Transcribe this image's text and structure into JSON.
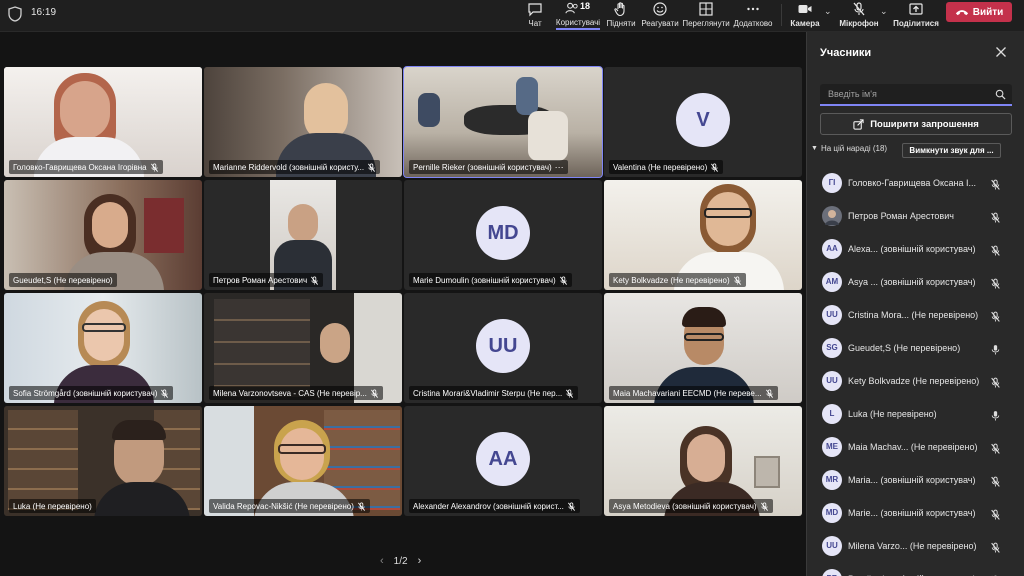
{
  "status": {
    "time": "16:19"
  },
  "toolbar": {
    "chat": "Чат",
    "people": "Користувачі",
    "people_count": "18",
    "raise": "Підняти",
    "react": "Реагувати",
    "view": "Переглянути",
    "more": "Додатково",
    "camera": "Камера",
    "mic": "Мікрофон",
    "share": "Поділитися",
    "leave": "Вийти"
  },
  "grid": {
    "tiles": [
      {
        "name": "Головко-Гаврищева Оксана Ігорівна",
        "type": "video",
        "mic": "off"
      },
      {
        "name": "Marianne Riddervold (зовнішній користу...",
        "type": "video",
        "mic": "off"
      },
      {
        "name": "Pernille Rieker (зовнішній користувач)",
        "type": "video",
        "mic": "more"
      },
      {
        "name": "Valentina (Не перевірено)",
        "type": "avatar",
        "initials": "V",
        "mic": "off"
      },
      {
        "name": "Gueudet,S (Не перевірено)",
        "type": "video",
        "mic": "none"
      },
      {
        "name": "Петров Роман Арестович",
        "type": "video",
        "mic": "off"
      },
      {
        "name": "Marie Dumoulin (зовнішній користувач)",
        "type": "avatar",
        "initials": "MD",
        "mic": "off"
      },
      {
        "name": "Kety Bolkvadze (Не перевірено)",
        "type": "video",
        "mic": "off"
      },
      {
        "name": "Sofia Strömgård (зовнішній користувач)",
        "type": "video",
        "mic": "off"
      },
      {
        "name": "Milena Varzonovtseva - CAS (Не перевір...",
        "type": "video",
        "mic": "off"
      },
      {
        "name": "Cristina Morari&Vladimir Sterpu (Не пер...",
        "type": "avatar",
        "initials": "UU",
        "mic": "off"
      },
      {
        "name": "Maia Machavariani EECMD (Не переве...",
        "type": "video",
        "mic": "off"
      },
      {
        "name": "Luka (Не перевірено)",
        "type": "video",
        "mic": "none"
      },
      {
        "name": "Valida Repovac-Nikšić (Не перевірено)",
        "type": "video",
        "mic": "off"
      },
      {
        "name": "Alexander Alexandrov (зовнішній корист...",
        "type": "avatar",
        "initials": "AA",
        "mic": "off"
      },
      {
        "name": "Asya Metodieva (зовнішній користувач)",
        "type": "video",
        "mic": "off"
      }
    ],
    "pager": "1/2"
  },
  "panel": {
    "title": "Учасники",
    "search_placeholder": "Введіть ім'я",
    "share_invite": "Поширити запрошення",
    "section_label": "На цій нараді (18)",
    "mute_all": "Вимкнути звук для ...",
    "participants": [
      {
        "initials": "ГІ",
        "name": "Головко-Гаврищева Оксана І...",
        "mic": "off"
      },
      {
        "initials": "",
        "photo": true,
        "name": "Петров Роман Арестович",
        "mic": "off"
      },
      {
        "initials": "AA",
        "name": "Alexa... (зовнішній користувач)",
        "mic": "off"
      },
      {
        "initials": "AM",
        "name": "Asya ... (зовнішній користувач)",
        "mic": "off"
      },
      {
        "initials": "UU",
        "name": "Cristina Mora... (Не перевірено)",
        "mic": "off"
      },
      {
        "initials": "SG",
        "name": "Gueudet,S (Не перевірено)",
        "mic": "on"
      },
      {
        "initials": "UU",
        "name": "Kety Bolkvadze (Не перевірено)",
        "mic": "off"
      },
      {
        "initials": "L",
        "name": "Luka (Не перевірено)",
        "mic": "on"
      },
      {
        "initials": "ME",
        "name": "Maia Machav... (Не перевірено)",
        "mic": "off"
      },
      {
        "initials": "MR",
        "name": "Maria... (зовнішній користувач)",
        "mic": "off"
      },
      {
        "initials": "MD",
        "name": "Marie... (зовнішній користувач)",
        "mic": "off"
      },
      {
        "initials": "UU",
        "name": "Milena Varzo... (Не перевірено)",
        "mic": "off"
      },
      {
        "initials": "PR",
        "name": "Pernil... (зовнішній користувач)",
        "mic": "off"
      }
    ]
  }
}
